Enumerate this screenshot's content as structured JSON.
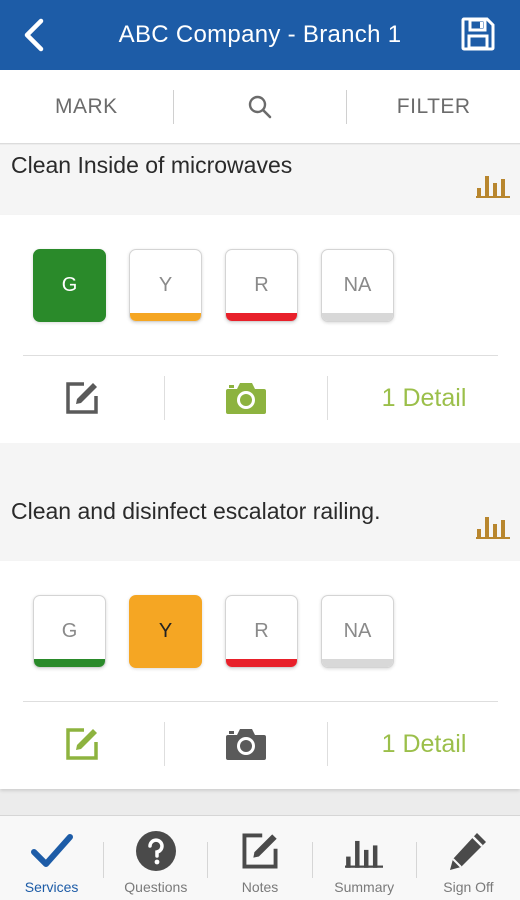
{
  "header": {
    "title": "ABC Company - Branch 1",
    "back_icon": "chevron-left-icon",
    "save_icon": "floppy-disk-icon",
    "bg_color": "#1d5ca7"
  },
  "filterbar": {
    "mark_label": "MARK",
    "search_icon": "search-icon",
    "filter_label": "FILTER"
  },
  "tasks": [
    {
      "name": "Clean Inside of microwaves",
      "ratings": [
        {
          "label": "G",
          "selected": true,
          "color": "#2a8a2a"
        },
        {
          "label": "Y",
          "selected": false,
          "color": "#f5a623"
        },
        {
          "label": "R",
          "selected": false,
          "color": "#e8202a"
        },
        {
          "label": "NA",
          "selected": false,
          "color": "#d8d8d8"
        }
      ],
      "detail": "1 Detail",
      "note_active": false,
      "camera_active": true
    },
    {
      "name": "Clean and disinfect escalator railing.",
      "ratings": [
        {
          "label": "G",
          "selected": false,
          "color": "#2a8a2a"
        },
        {
          "label": "Y",
          "selected": true,
          "color": "#f5a623"
        },
        {
          "label": "R",
          "selected": false,
          "color": "#e8202a"
        },
        {
          "label": "NA",
          "selected": false,
          "color": "#d8d8d8"
        }
      ],
      "detail": "1 Detail",
      "note_active": true,
      "camera_active": false
    }
  ],
  "tabs": [
    {
      "label": "Services",
      "icon": "checkmark-icon",
      "active": true
    },
    {
      "label": "Questions",
      "icon": "question-icon",
      "active": false
    },
    {
      "label": "Notes",
      "icon": "edit-note-icon",
      "active": false
    },
    {
      "label": "Summary",
      "icon": "bar-chart-icon",
      "active": false
    },
    {
      "label": "Sign Off",
      "icon": "pencil-icon",
      "active": false
    }
  ],
  "colors": {
    "accent": "#1d5ca7",
    "detail_green": "#9bbf4a",
    "stats_gold": "#b8862e",
    "icon_gray": "#5a5a5a"
  }
}
